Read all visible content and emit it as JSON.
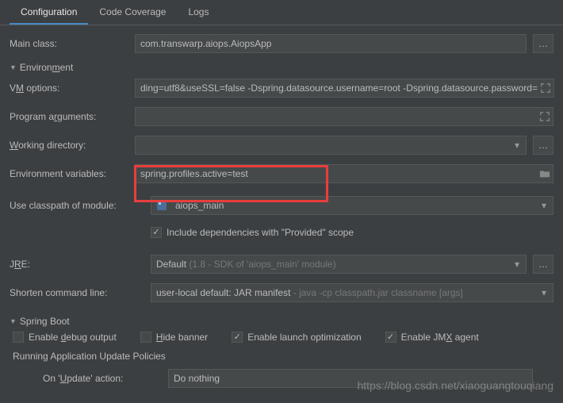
{
  "tabs": {
    "configuration": "Configuration",
    "code_coverage": "Code Coverage",
    "logs": "Logs"
  },
  "main_class": {
    "label": "Main class:",
    "value": "com.transwarp.aiops.AiopsApp"
  },
  "sections": {
    "environment": "Environment",
    "spring_boot": "Spring Boot",
    "update_policies": "Running Application Update Policies"
  },
  "vm_options": {
    "label_pre": "V",
    "label_m": "M",
    "label_post": " options:",
    "value": "ding=utf8&useSSL=false -Dspring.datasource.username=root -Dspring.datasource.password="
  },
  "program_args": {
    "label_pre": "Program a",
    "label_m": "r",
    "label_post": "guments:",
    "value": ""
  },
  "working_dir": {
    "label_pre": "",
    "label_m": "W",
    "label_post": "orking directory:",
    "value": ""
  },
  "env_vars": {
    "label": "Environment variables:",
    "value": "spring.profiles.active=test"
  },
  "classpath": {
    "label": "Use classpath of module:",
    "value": "aiops_main",
    "include_provided": "Include dependencies with \"Provided\" scope"
  },
  "jre": {
    "label_pre": "J",
    "label_m": "R",
    "label_post": "E:",
    "value_main": "Default ",
    "value_dim": "(1.8 - SDK of 'aiops_main' module)"
  },
  "shorten": {
    "label": "Shorten command line:",
    "value_main": "user-local default: JAR manifest ",
    "value_dim": "- java -cp classpath.jar classname [args]"
  },
  "spring": {
    "debug_pre": "Enable ",
    "debug_m": "d",
    "debug_post": "ebug output",
    "hide_m": "H",
    "hide_post": "ide banner",
    "launch": "Enable launch optimization",
    "jmx_pre": "Enable JM",
    "jmx_m": "X",
    "jmx_post": " agent"
  },
  "update": {
    "label_pre": "On '",
    "label_m": "U",
    "label_post": "pdate' action:",
    "value": "Do nothing"
  },
  "watermark": "https://blog.csdn.net/xiaoguangtouqiang"
}
